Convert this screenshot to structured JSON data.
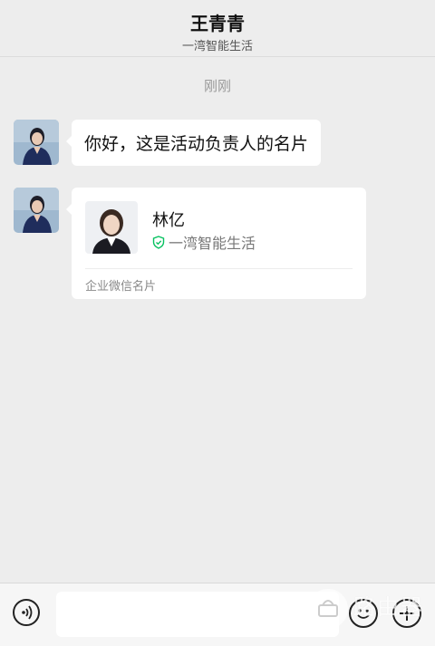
{
  "header": {
    "title": "王青青",
    "subtitle": "一湾智能生活"
  },
  "chat": {
    "timestamp": "刚刚",
    "text_message": "你好，这是活动负责人的名片",
    "contact_card": {
      "name": "林亿",
      "company": "一湾智能生活",
      "footer": "企业微信名片"
    }
  },
  "input_bar": {
    "placeholder": ""
  },
  "watermark": {
    "text": "路由器"
  },
  "colors": {
    "background": "#ededed",
    "bubble": "#ffffff",
    "verified": "#07c160"
  },
  "icons": [
    "voice-icon",
    "emoji-icon",
    "plus-icon",
    "verified-shield-icon"
  ]
}
